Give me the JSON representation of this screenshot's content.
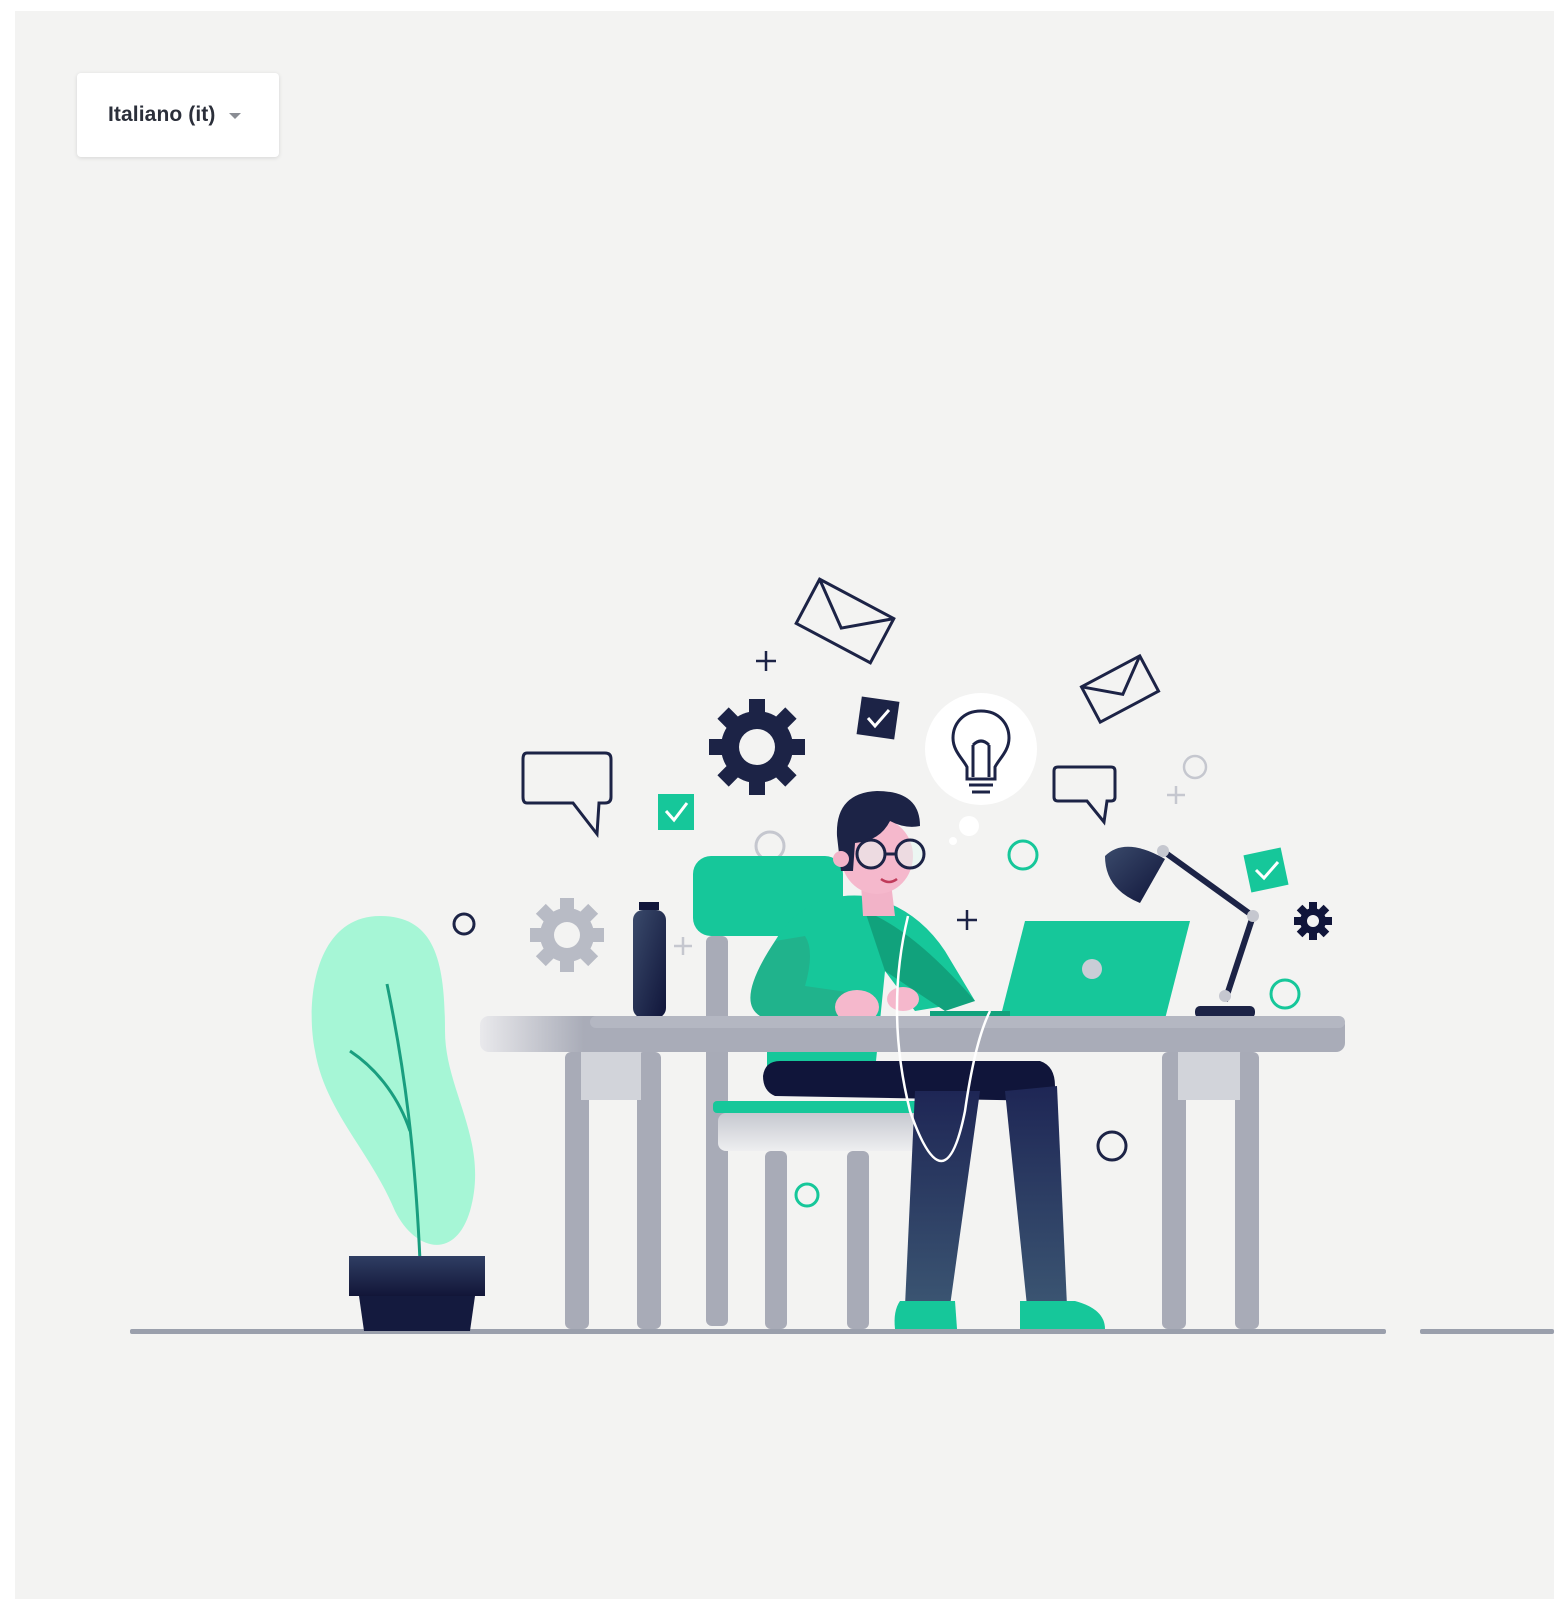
{
  "language_selector": {
    "selected": "Italiano (it)",
    "icon": "caret-down-icon"
  },
  "illustration": {
    "subject": "person-working-at-laptop",
    "colors": {
      "background": "#f3f3f2",
      "accent_green": "#16c79a",
      "light_green": "#a3f5d6",
      "navy": "#1c2346",
      "grey": "#a8abb7",
      "skin": "#f2b3c8"
    }
  }
}
